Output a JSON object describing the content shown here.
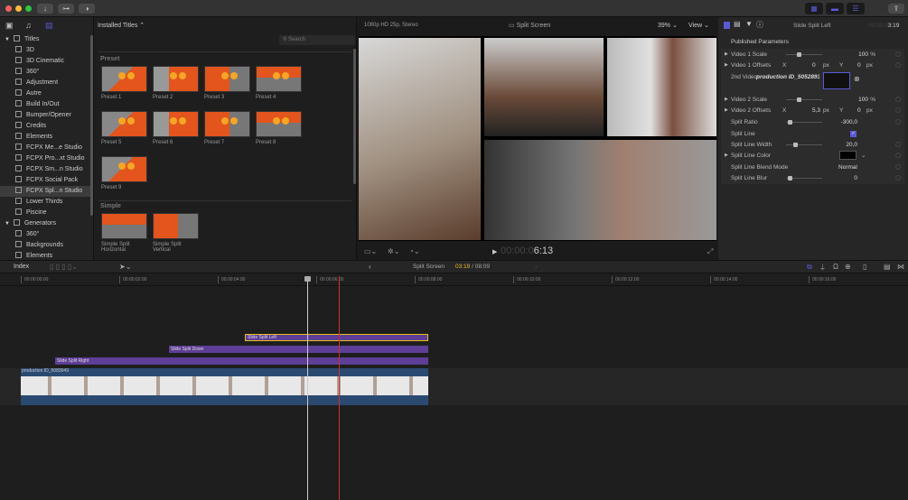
{
  "window": {
    "toolbar_icons": [
      "import-icon",
      "keywords-icon",
      "background-tasks-icon"
    ],
    "workspace_icons": [
      "browser-layout-icon",
      "timeline-layout-icon",
      "inspector-layout-icon"
    ],
    "share_icon": "share-icon"
  },
  "sidebar": {
    "tabs": [
      "libraries-icon",
      "photos-audio-icon",
      "titles-generators-icon"
    ],
    "items": [
      {
        "label": "Titles",
        "group": true
      },
      {
        "label": "3D"
      },
      {
        "label": "3D Cinematic"
      },
      {
        "label": "360°"
      },
      {
        "label": "Adjustment"
      },
      {
        "label": "Autre"
      },
      {
        "label": "Build In/Out"
      },
      {
        "label": "Bumper/Opener"
      },
      {
        "label": "Credits"
      },
      {
        "label": "Elements"
      },
      {
        "label": "FCPX Me...e Studio"
      },
      {
        "label": "FCPX Pro...xt Studio"
      },
      {
        "label": "FCPX Sm...n Studio"
      },
      {
        "label": "FCPX Social Pack"
      },
      {
        "label": "FCPX Spl...n Studio",
        "selected": true
      },
      {
        "label": "Lower Thirds"
      },
      {
        "label": "Piscine"
      },
      {
        "label": "Generators",
        "group": true
      },
      {
        "label": "360°"
      },
      {
        "label": "Backgrounds"
      },
      {
        "label": "Elements"
      }
    ]
  },
  "browser": {
    "source": "Installed Titles",
    "search_placeholder": "Search",
    "sections": [
      {
        "title": "Preset",
        "items": [
          "Preset 1",
          "Preset 2",
          "Preset 3",
          "Preset 4",
          "Preset 5",
          "Preset 6",
          "Preset 7",
          "Preset 8",
          "Preset 9"
        ]
      },
      {
        "title": "Simple",
        "items": [
          "Simple Split Horizontal",
          "Simple Split Vertical"
        ]
      }
    ]
  },
  "viewer": {
    "format": "1080p HD 25p, Stereo",
    "title": "Split Screen",
    "zoom": "39%",
    "view_label": "View",
    "timecode_dim": "00:00:0",
    "timecode": "6:13"
  },
  "inspector": {
    "title": "Slide Split Left",
    "timecode_dim": "00:00:0",
    "timecode": "3:19",
    "section": "Published Parameters",
    "params": [
      {
        "label": "Video 1 Scale",
        "value": "100",
        "unit": "%",
        "slider": 0.3,
        "disclosure": true
      },
      {
        "label": "Video 1 Offsets",
        "x": "0",
        "y": "0",
        "unit": "px",
        "disclosure": true
      },
      {
        "label": "2nd Video:",
        "value": "production ID_5052893"
      },
      {
        "label": "Video 2 Scale",
        "value": "100",
        "unit": "%",
        "slider": 0.3,
        "disclosure": true
      },
      {
        "label": "Video 2 Offsets",
        "x": "5,3",
        "y": "0",
        "unit": "px",
        "disclosure": true
      },
      {
        "label": "Split Ratio",
        "value": "-300,0",
        "slider": 0.05
      },
      {
        "label": "Split Line",
        "checked": true
      },
      {
        "label": "Split Line Width",
        "value": "20,0",
        "slider": 0.2
      },
      {
        "label": "Split Line Color",
        "color": "#000000",
        "disclosure": true
      },
      {
        "label": "Split Line Blend Mode",
        "value": "Normal"
      },
      {
        "label": "Split Line Blur",
        "value": "0",
        "slider": 0.05
      }
    ]
  },
  "timeline": {
    "index_label": "Index",
    "project": "Split Screen",
    "position": "03:19",
    "duration": "08:09",
    "ruler": [
      "00:00:00:00",
      "00:00:02:00",
      "00:00:04:00",
      "00:00:06:00",
      "00:00:08:00",
      "00:00:10:00",
      "00:00:12:00",
      "00:00:14:00",
      "00:00:16:00"
    ],
    "clips": [
      {
        "label": "Slide Split Left",
        "selected": true
      },
      {
        "label": "Slide Split Down"
      },
      {
        "label": "Slide Split Right"
      },
      {
        "label": "production ID_5083049"
      }
    ]
  },
  "colors": {
    "accent": "#5a5ad8",
    "title_clip": "#5e3e96",
    "selected": "#e8c020",
    "playhead_skimmer": "#d03030"
  }
}
